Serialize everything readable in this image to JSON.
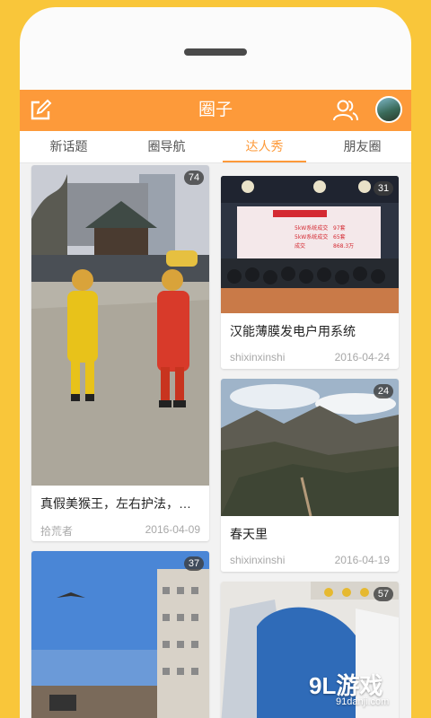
{
  "header": {
    "title": "圈子"
  },
  "tabs": [
    {
      "label": "新话题"
    },
    {
      "label": "圈导航"
    },
    {
      "label": "达人秀"
    },
    {
      "label": "朋友圈"
    }
  ],
  "active_tab": "达人秀",
  "cards": [
    {
      "title": "真假美猴王，左右护法，猴...",
      "author": "拾荒者",
      "date": "2016-04-09",
      "count": "74"
    },
    {
      "title": "汉能薄膜发电户用系统",
      "author": "shixinxinshi",
      "date": "2016-04-24",
      "count": "31"
    },
    {
      "title": "春天里",
      "author": "shixinxinshi",
      "date": "2016-04-19",
      "count": "24"
    },
    {
      "title": "",
      "author": "",
      "date": "",
      "count": "37"
    },
    {
      "title": "",
      "author": "",
      "date": "",
      "count": "57"
    }
  ],
  "slide_text": [
    "5kW系统成交",
    "97套",
    "5kW系统成交",
    "65套",
    "成交",
    "868.3万"
  ],
  "watermark": {
    "brand": "9L游戏",
    "url": "91danji.com"
  },
  "colors": {
    "accent": "#fd9a3a",
    "frame": "#f9c63a"
  }
}
